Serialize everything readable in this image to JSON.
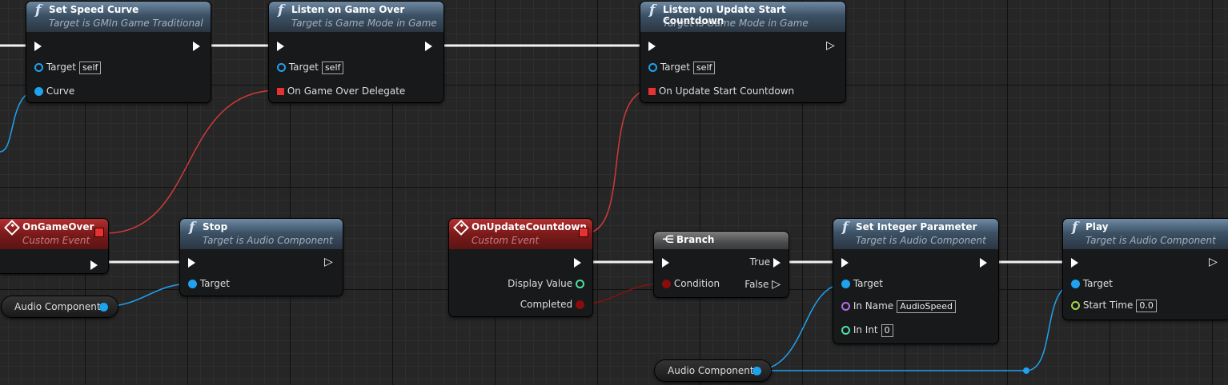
{
  "nodes": {
    "set_speed_curve": {
      "title": "Set Speed Curve",
      "subtitle": "Target is GMIn Game Traditional",
      "pin_target": "Target",
      "self": "self",
      "pin_curve": "Curve"
    },
    "listen_game_over": {
      "title": "Listen on Game Over",
      "subtitle": "Target is Game Mode in Game",
      "pin_target": "Target",
      "self": "self",
      "pin_delegate": "On Game Over Delegate"
    },
    "listen_update": {
      "title": "Listen on Update Start Countdown",
      "subtitle": "Target is Game Mode in Game",
      "pin_target": "Target",
      "self": "self",
      "pin_delegate": "On Update Start Countdown"
    },
    "on_game_over": {
      "title": "OnGameOver",
      "subtitle": "Custom Event"
    },
    "stop": {
      "title": "Stop",
      "subtitle": "Target is Audio Component",
      "pin_target": "Target"
    },
    "on_update_countdown": {
      "title": "OnUpdateCountdown",
      "subtitle": "Custom Event",
      "pin_display": "Display Value",
      "pin_completed": "Completed"
    },
    "branch": {
      "title": "Branch",
      "pin_condition": "Condition",
      "pin_true": "True",
      "pin_false": "False"
    },
    "set_integer": {
      "title": "Set Integer Parameter",
      "subtitle": "Target is Audio Component",
      "pin_target": "Target",
      "pin_in_name": "In Name",
      "in_name_value": "AudioSpeed",
      "pin_in_int": "In Int",
      "in_int_value": "0"
    },
    "play": {
      "title": "Play",
      "subtitle": "Target is Audio Component",
      "pin_target": "Target",
      "pin_start_time": "Start Time",
      "start_time_value": "0.0"
    }
  },
  "variables": {
    "audio_component_1": "Audio Component",
    "audio_component_2": "Audio Component"
  },
  "colors": {
    "exec": "#ffffff",
    "object": "#1fa2ef",
    "delegate": "#e63232",
    "bool": "#8a0c0c",
    "int": "#4fdea5",
    "name": "#b16fe0",
    "float": "#a5d84a"
  },
  "icons": {
    "function": "function-icon",
    "event": "event-icon",
    "branch": "branch-icon"
  }
}
